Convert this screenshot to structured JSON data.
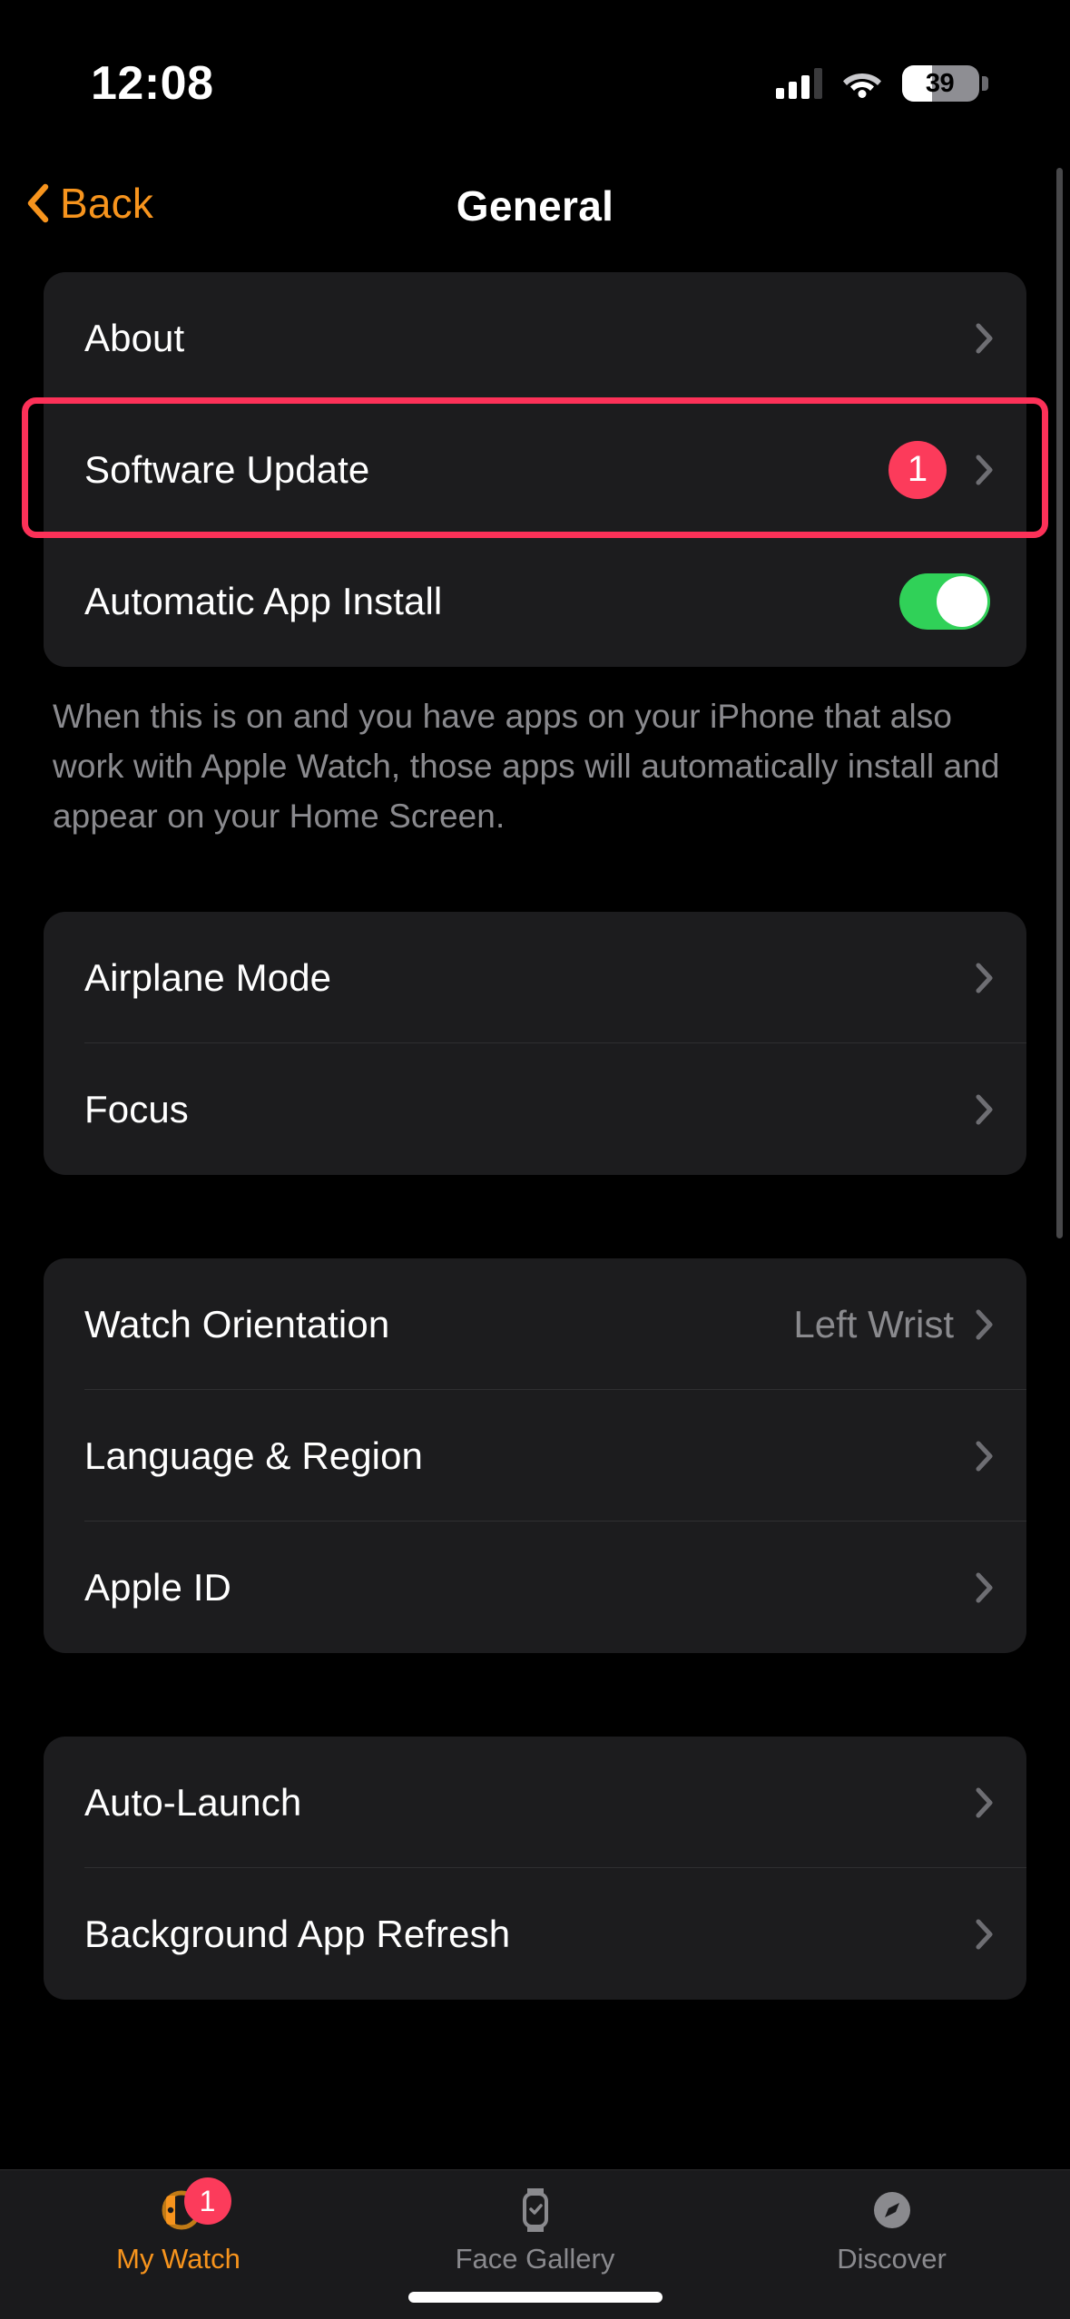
{
  "status_bar": {
    "time": "12:08",
    "battery_level": "39",
    "icons": [
      "cellular-signal-icon",
      "wifi-icon",
      "battery-icon"
    ]
  },
  "nav": {
    "back_label": "Back",
    "title": "General"
  },
  "sections": [
    {
      "id": "updates",
      "rows": [
        {
          "label": "About",
          "type": "disclosure"
        },
        {
          "label": "Software Update",
          "type": "disclosure",
          "badge": "1",
          "highlighted": true
        },
        {
          "label": "Automatic App Install",
          "type": "toggle",
          "toggle_on": true
        }
      ],
      "footnote": "When this is on and you have apps on your iPhone that also work with Apple Watch, those apps will automatically install and appear on your Home Screen."
    },
    {
      "id": "connectivity",
      "rows": [
        {
          "label": "Airplane Mode",
          "type": "disclosure"
        },
        {
          "label": "Focus",
          "type": "disclosure"
        }
      ]
    },
    {
      "id": "device",
      "rows": [
        {
          "label": "Watch Orientation",
          "type": "disclosure",
          "value": "Left Wrist"
        },
        {
          "label": "Language & Region",
          "type": "disclosure"
        },
        {
          "label": "Apple ID",
          "type": "disclosure"
        }
      ]
    },
    {
      "id": "apps",
      "rows": [
        {
          "label": "Auto-Launch",
          "type": "disclosure"
        },
        {
          "label": "Background App Refresh",
          "type": "disclosure"
        }
      ]
    }
  ],
  "tabs": [
    {
      "label": "My Watch",
      "icon": "watch-icon",
      "active": true,
      "badge": "1"
    },
    {
      "label": "Face Gallery",
      "icon": "watch-face-icon",
      "active": false
    },
    {
      "label": "Discover",
      "icon": "compass-icon",
      "active": false
    }
  ],
  "colors": {
    "accent": "#F7941D",
    "badge_red": "#FC3B5B",
    "highlight_red": "#FC3158",
    "toggle_green": "#30D158",
    "card_bg": "#1C1C1E",
    "secondary_text": "#8A8A8E"
  }
}
